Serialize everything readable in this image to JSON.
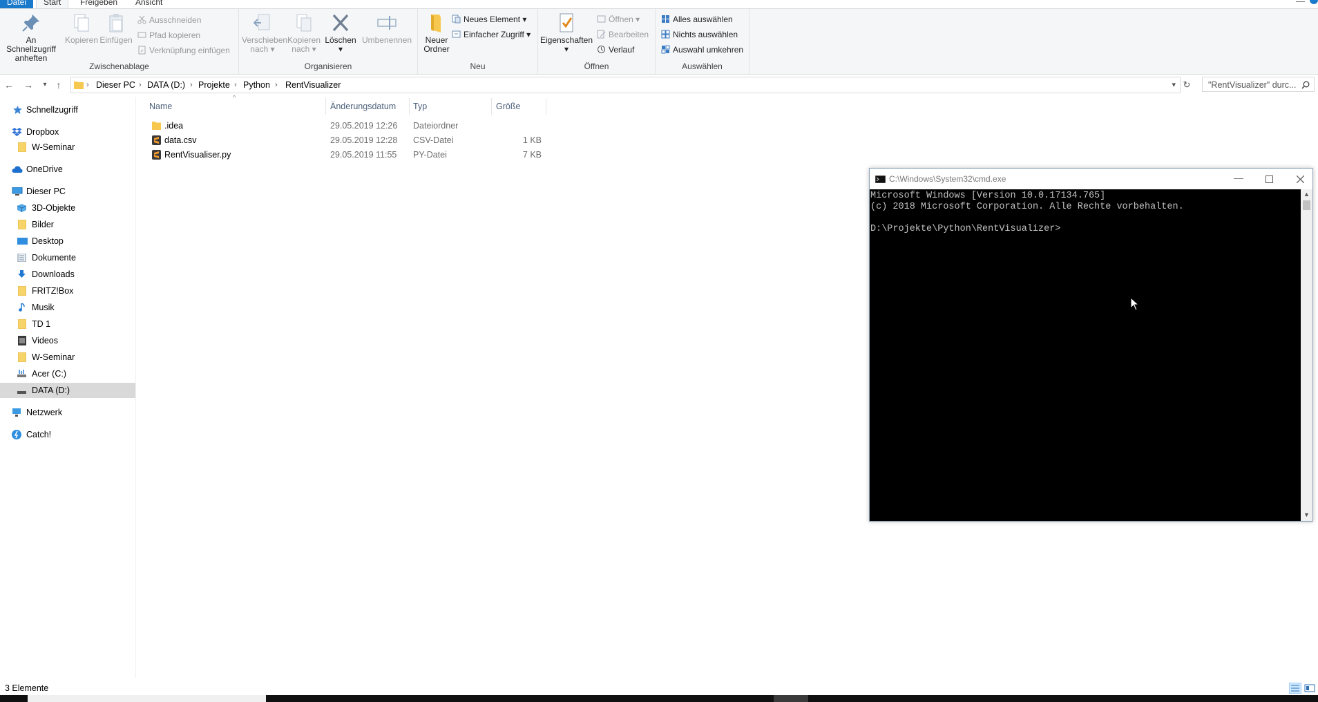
{
  "ribbon_tabs": [
    "Datei",
    "Start",
    "Freigeben",
    "Ansicht"
  ],
  "ribbon": {
    "clipboard": {
      "pin_label_1": "An Schnellzugriff",
      "pin_label_2": "anheften",
      "copy_label": "Kopieren",
      "paste_label": "Einfügen",
      "cut_label": "Ausschneiden",
      "copy_path_label": "Pfad kopieren",
      "paste_shortcut_label": "Verknüpfung einfügen",
      "group_label": "Zwischenablage"
    },
    "organize": {
      "move_label_1": "Verschieben",
      "move_label_2": "nach",
      "copyto_label_1": "Kopieren",
      "copyto_label_2": "nach",
      "delete_label": "Löschen",
      "rename_label": "Umbenennen",
      "group_label": "Organisieren"
    },
    "new": {
      "new_folder_label_1": "Neuer",
      "new_folder_label_2": "Ordner",
      "new_item_label": "Neues Element",
      "easy_access_label": "Einfacher Zugriff",
      "group_label": "Neu"
    },
    "open": {
      "properties_label": "Eigenschaften",
      "open_label": "Öffnen",
      "edit_label": "Bearbeiten",
      "history_label": "Verlauf",
      "group_label": "Öffnen"
    },
    "select": {
      "select_all_label": "Alles auswählen",
      "select_none_label": "Nichts auswählen",
      "invert_label": "Auswahl umkehren",
      "group_label": "Auswählen"
    }
  },
  "address": {
    "crumbs": [
      "Dieser PC",
      "DATA (D:)",
      "Projekte",
      "Python",
      "RentVisualizer"
    ],
    "search_placeholder": "\"RentVisualizer\" durc..."
  },
  "sidebar": {
    "items": [
      {
        "label": "Schnellzugriff",
        "icon": "star-icon",
        "level": 0
      },
      {
        "label": "Dropbox",
        "icon": "dropbox-icon",
        "level": 0
      },
      {
        "label": "W-Seminar",
        "icon": "folder-icon",
        "level": 1
      },
      {
        "label": "OneDrive",
        "icon": "cloud-icon",
        "level": 0
      },
      {
        "label": "Dieser PC",
        "icon": "computer-icon",
        "level": 0
      },
      {
        "label": "3D-Objekte",
        "icon": "cube-icon",
        "level": 1
      },
      {
        "label": "Bilder",
        "icon": "folder-icon",
        "level": 1
      },
      {
        "label": "Desktop",
        "icon": "desktop-icon",
        "level": 1
      },
      {
        "label": "Dokumente",
        "icon": "document-icon",
        "level": 1
      },
      {
        "label": "Downloads",
        "icon": "download-icon",
        "level": 1
      },
      {
        "label": "FRITZ!Box",
        "icon": "folder-icon",
        "level": 1
      },
      {
        "label": "Musik",
        "icon": "music-icon",
        "level": 1
      },
      {
        "label": "TD 1",
        "icon": "folder-icon",
        "level": 1
      },
      {
        "label": "Videos",
        "icon": "video-icon",
        "level": 1
      },
      {
        "label": "W-Seminar",
        "icon": "folder-icon",
        "level": 1
      },
      {
        "label": "Acer (C:)",
        "icon": "drive-icon",
        "level": 1
      },
      {
        "label": "DATA (D:)",
        "icon": "drive-icon",
        "level": 1,
        "selected": true
      },
      {
        "label": "Netzwerk",
        "icon": "network-icon",
        "level": 0
      },
      {
        "label": "Catch!",
        "icon": "catch-icon",
        "level": 0
      }
    ]
  },
  "file_list": {
    "columns": [
      "Name",
      "Änderungsdatum",
      "Typ",
      "Größe"
    ],
    "rows": [
      {
        "name": ".idea",
        "date": "29.05.2019 12:26",
        "type": "Dateiordner",
        "size": "",
        "icon": "folder-icon"
      },
      {
        "name": "data.csv",
        "date": "29.05.2019 12:28",
        "type": "CSV-Datei",
        "size": "1 KB",
        "icon": "sublime-file-icon"
      },
      {
        "name": "RentVisualiser.py",
        "date": "29.05.2019 11:55",
        "type": "PY-Datei",
        "size": "7 KB",
        "icon": "sublime-file-icon"
      }
    ]
  },
  "status": {
    "count": "3 Elemente"
  },
  "cmd": {
    "title": "C:\\Windows\\System32\\cmd.exe",
    "lines": [
      "Microsoft Windows [Version 10.0.17134.765]",
      "(c) 2018 Microsoft Corporation. Alle Rechte vorbehalten.",
      "",
      "D:\\Projekte\\Python\\RentVisualizer>"
    ]
  },
  "colors": {
    "accent": "#1979ca",
    "selection": "#d9d9d9",
    "console_bg": "#000000",
    "console_fg": "#c0c0c0"
  }
}
